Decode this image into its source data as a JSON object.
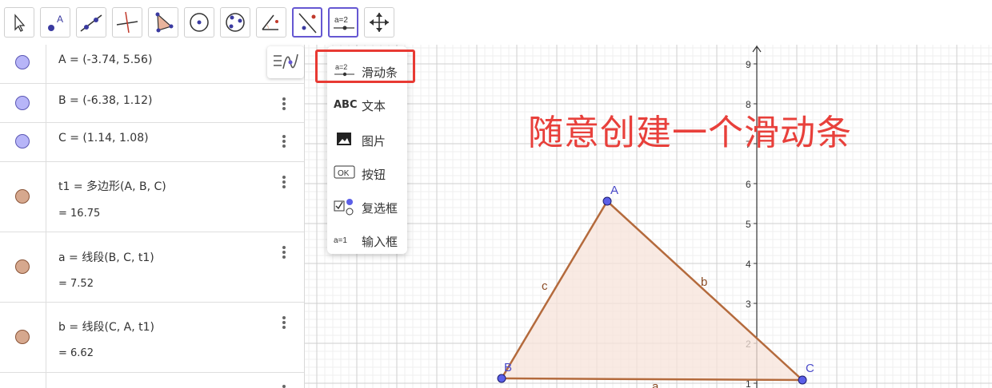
{
  "toolbar": {
    "tools": [
      {
        "name": "move-tool",
        "icon": "cursor-arrow-icon"
      },
      {
        "name": "point-tool",
        "icon": "point-icon",
        "label": "A"
      },
      {
        "name": "line-tool",
        "icon": "line-icon"
      },
      {
        "name": "perpendicular-line-tool",
        "icon": "perpendicular-icon"
      },
      {
        "name": "polygon-tool",
        "icon": "polygon-icon"
      },
      {
        "name": "circle-center-point-tool",
        "icon": "circle-center-icon"
      },
      {
        "name": "circle-three-points-tool",
        "icon": "circle-three-points-icon"
      },
      {
        "name": "angle-tool",
        "icon": "angle-icon"
      },
      {
        "name": "reflect-tool",
        "icon": "reflect-icon",
        "selected": true
      },
      {
        "name": "slider-tool",
        "icon": "slider-icon",
        "label": "a=2",
        "selected": true
      },
      {
        "name": "move-graphics-view-tool",
        "icon": "move-arrows-icon"
      }
    ]
  },
  "algebra": {
    "rows": [
      {
        "text": "A = (-3.74, 5.56)",
        "color": "#b7b5f8",
        "border": "#5b57b4"
      },
      {
        "text": "B = (-6.38, 1.12)",
        "color": "#b7b5f8",
        "border": "#5b57b4"
      },
      {
        "text": "C = (1.14, 1.08)",
        "color": "#b7b5f8",
        "border": "#5b57b4"
      },
      {
        "text": "t1 = 多边形(A, B, C)",
        "value": "= 16.75",
        "color": "#d6a88e",
        "border": "#8a5437"
      },
      {
        "text": "a = 线段(B, C, t1)",
        "value": "= 7.52",
        "color": "#d6a88e",
        "border": "#8a5437"
      },
      {
        "text": "b = 线段(C, A, t1)",
        "value": "= 6.62",
        "color": "#d6a88e",
        "border": "#8a5437"
      }
    ]
  },
  "menu": {
    "items": [
      {
        "label": "滑动条",
        "icon": "slider-icon",
        "icon_text": "a=2"
      },
      {
        "label": "文本",
        "icon": "text-abc-icon",
        "icon_text": "ABC"
      },
      {
        "label": "图片",
        "icon": "image-icon"
      },
      {
        "label": "按钮",
        "icon": "button-ok-icon",
        "icon_text": "OK"
      },
      {
        "label": "复选框",
        "icon": "checkbox-icon"
      },
      {
        "label": "输入框",
        "icon": "input-box-icon",
        "icon_text": "a=1"
      }
    ]
  },
  "graphics": {
    "y_ticks": [
      "1",
      "2",
      "3",
      "4",
      "5",
      "6",
      "7",
      "8",
      "9"
    ],
    "points": [
      {
        "label": "A",
        "x": -3.74,
        "y": 5.56
      },
      {
        "label": "B",
        "x": -6.38,
        "y": 1.12
      },
      {
        "label": "C",
        "x": 1.14,
        "y": 1.08
      }
    ],
    "segment_labels": {
      "a": "a",
      "b": "b",
      "c": "c"
    },
    "annotation": "随意创建一个滑动条"
  },
  "colors": {
    "accent": "#6557d2",
    "point_fill": "#5b5fe8",
    "polygon_stroke": "#b46a3c",
    "polygon_fill": "#f7e3da",
    "label_point": "#4a4ac9",
    "label_segment": "#8a4a23",
    "highlight": "#e83a33"
  }
}
